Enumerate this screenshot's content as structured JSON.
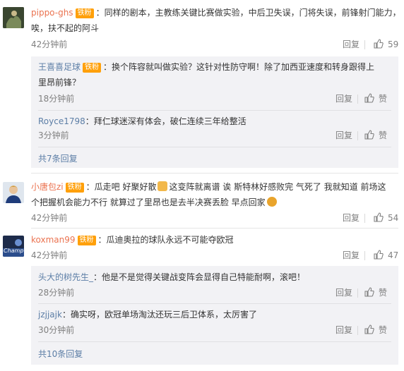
{
  "labels": {
    "reply": "回复",
    "like": "赞",
    "badge": "铁粉"
  },
  "comments": [
    {
      "user": "pippo-ghs",
      "text1": "：同样的剧本，主教练关键比赛做实验，中后卫失误，门将失误，前锋射门能力，",
      "text2": "唉，扶不起的阿斗",
      "time": "42分钟前",
      "likes": "59",
      "replies": [
        {
          "user": "王喜喜足球",
          "text1": "：换个阵容就叫做实验？这针对性防守啊！除了加西亚速度和转身跟得上",
          "text2": "里昂前锋？",
          "time": "18分钟前"
        },
        {
          "user": "Royce1798",
          "text1": "：拜仁球迷深有体会，破仁连续三年给整活",
          "time": "3分钟前"
        }
      ],
      "more": "共7条回复"
    },
    {
      "user": "小唐包zi",
      "text1a": "：瓜走吧  好聚好散",
      "text1b": "这变阵就离谱  诶  斯特林好感败完  气死了  我就知道  前场这",
      "text2": "个把握机会能力不行  就算过了里昂也是去半决赛丢脸  早点回家",
      "time": "42分钟前",
      "likes": "54"
    },
    {
      "user": "koxman99",
      "text1": "：瓜迪奥拉的球队永远不可能夺欧冠",
      "time": "42分钟前",
      "likes": "47",
      "avatar_text": "Champ",
      "replies": [
        {
          "user": "头大的树先生_",
          "text1": "：他是不是觉得关键战变阵会显得自己特能耐啊，滚吧！",
          "time": "28分钟前"
        },
        {
          "user": "jzjjajk",
          "text1": "：确实呀，欧冠单场淘汰还玩三后卫体系，太厉害了",
          "time": "30分钟前"
        }
      ],
      "more": "共10条回复"
    }
  ],
  "colors": {
    "username_orange": "#eb7350",
    "username_blue": "#5c7ea6",
    "badge_orange": "#ffa00a",
    "reply_bg": "#f2f2f5"
  }
}
